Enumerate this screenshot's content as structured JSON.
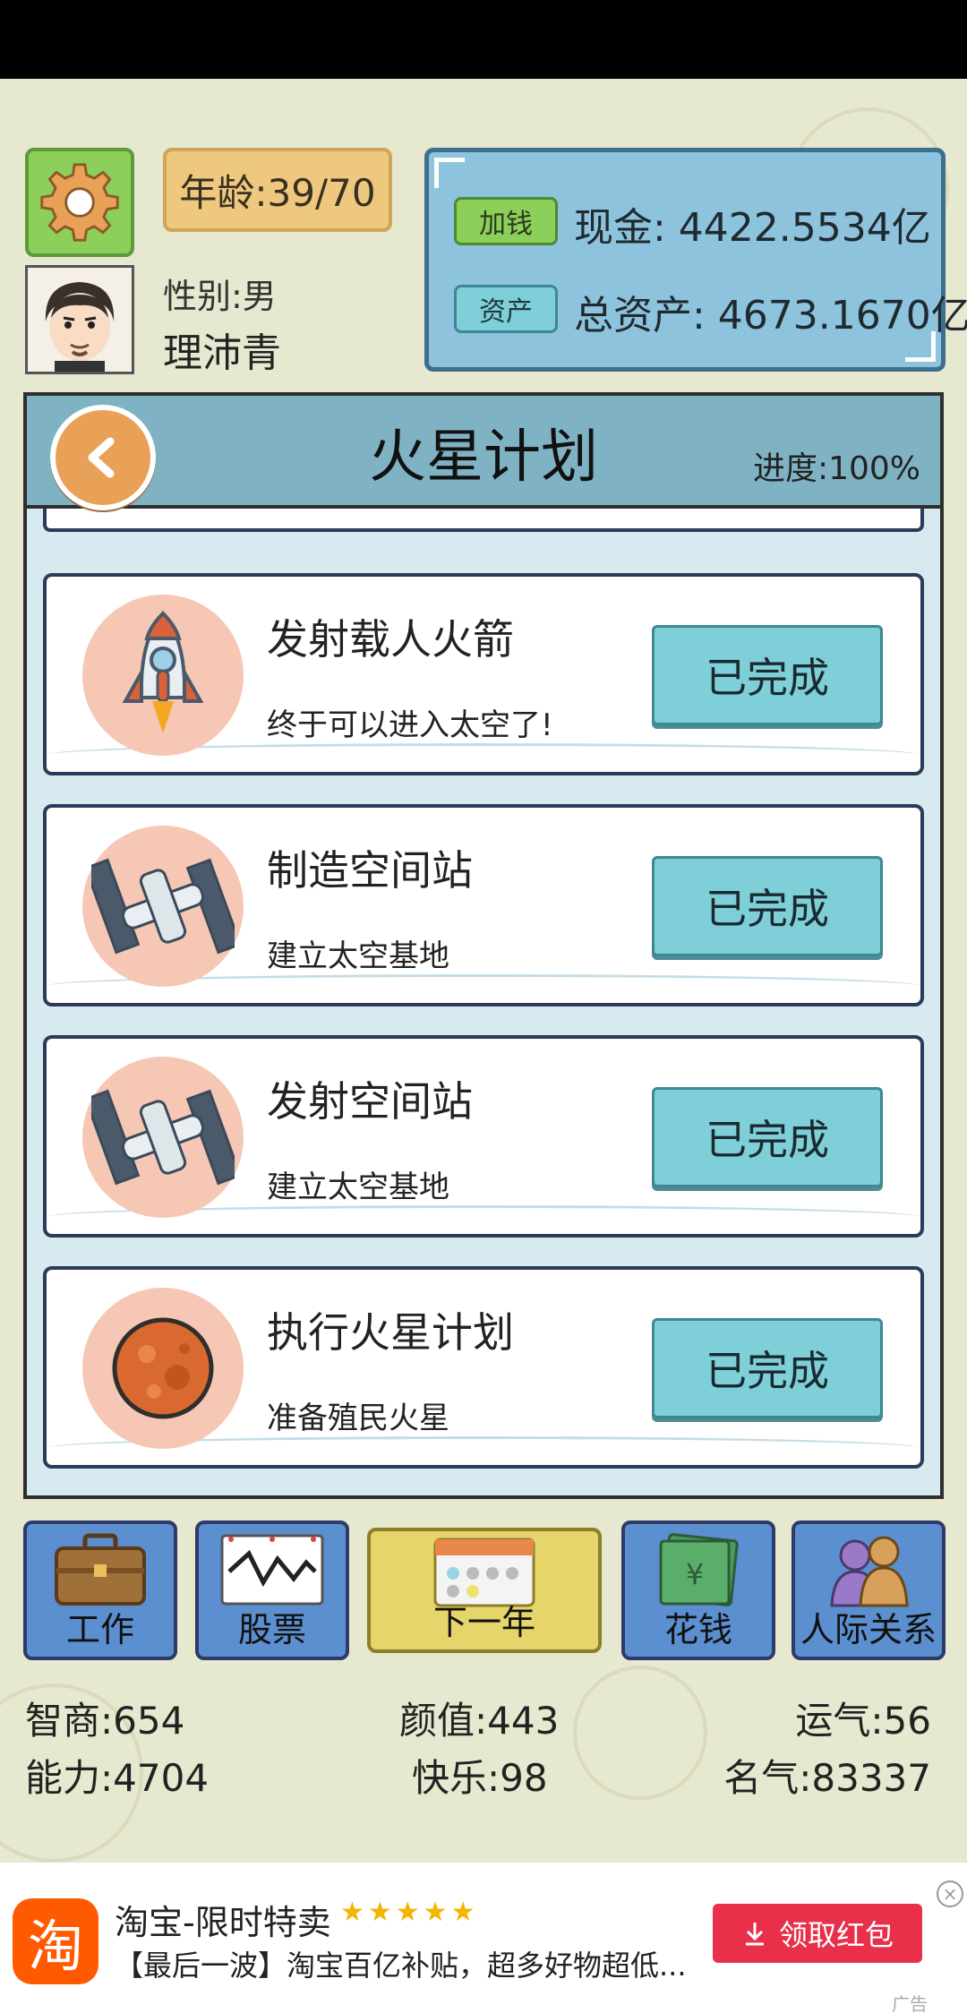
{
  "player": {
    "age": "年龄:39/70",
    "gender": "性别:男",
    "name": "理沛青"
  },
  "finance": {
    "cash_button": "加钱",
    "asset_button": "资产",
    "cash": "现金: 4422.5534亿",
    "assets": "总资产: 4673.1670亿"
  },
  "plan": {
    "title": "火星计划",
    "progress": "进度:100%",
    "tasks": [
      {
        "name": "发射载人火箭",
        "desc": "终于可以进入太空了!",
        "status": "已完成",
        "icon": "rocket-icon"
      },
      {
        "name": "制造空间站",
        "desc": "建立太空基地",
        "status": "已完成",
        "icon": "space-station-icon"
      },
      {
        "name": "发射空间站",
        "desc": "建立太空基地",
        "status": "已完成",
        "icon": "space-station-icon"
      },
      {
        "name": "执行火星计划",
        "desc": "准备殖民火星",
        "status": "已完成",
        "icon": "mars-icon"
      }
    ]
  },
  "nav": {
    "work": "工作",
    "stocks": "股票",
    "next_year": "下一年",
    "spend": "花钱",
    "relations": "人际关系"
  },
  "stats": {
    "iq": "智商:654",
    "looks": "颜值:443",
    "luck": "运气:56",
    "ability": "能力:4704",
    "happiness": "快乐:98",
    "fame": "名气:83337"
  },
  "ad": {
    "logo": "淘",
    "title": "淘宝-限时特卖",
    "stars": "★★★★★",
    "desc": "【最后一波】淘宝百亿补贴，超多好物超低...",
    "cta": "领取红包",
    "close": "×",
    "tag": "广告"
  },
  "colors": {
    "background": "#e6e8cf",
    "panel": "#d7eaef",
    "title_bar": "#7fb3c4",
    "done_button": "#7ecfd8",
    "nav_blue": "#5b8fd0",
    "nav_yellow": "#e6d56b",
    "ad_red": "#e8304a"
  }
}
